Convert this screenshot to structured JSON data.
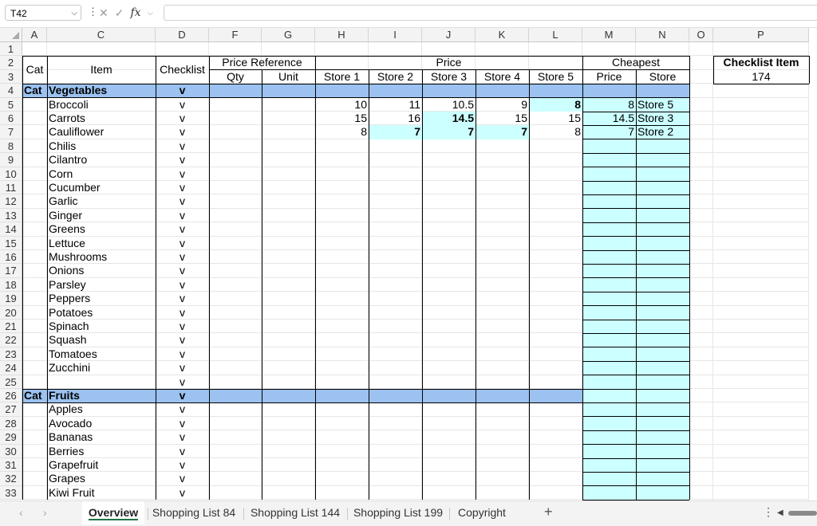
{
  "formula_bar": {
    "name_box": "T42",
    "fx_label": "fx",
    "formula": ""
  },
  "columns": [
    "A",
    "C",
    "D",
    "F",
    "G",
    "H",
    "I",
    "J",
    "K",
    "L",
    "M",
    "N",
    "O",
    "P"
  ],
  "row_numbers": [
    "1",
    "2",
    "3",
    "4",
    "5",
    "6",
    "7",
    "8",
    "9",
    "10",
    "11",
    "12",
    "13",
    "14",
    "15",
    "16",
    "17",
    "18",
    "19",
    "20",
    "21",
    "22",
    "23",
    "24",
    "25",
    "26",
    "27",
    "28",
    "29",
    "30",
    "31",
    "32",
    "33"
  ],
  "headers": {
    "cat": "Cat",
    "item": "Item",
    "checklist": "Checklist",
    "price_reference": "Price Reference",
    "qty": "Qty",
    "unit": "Unit",
    "price": "Price",
    "store1": "Store 1",
    "store2": "Store 2",
    "store3": "Store 3",
    "store4": "Store 4",
    "store5": "Store 5",
    "cheapest": "Cheapest",
    "cheapest_price": "Price",
    "cheapest_store": "Store"
  },
  "checklist_item": {
    "label": "Checklist Item",
    "value": "174"
  },
  "categories": [
    {
      "row": 4,
      "cat": "Cat",
      "name": "Vegetables",
      "check": "v"
    },
    {
      "row": 26,
      "cat": "Cat",
      "name": "Fruits",
      "check": "v"
    }
  ],
  "items": [
    {
      "row": 5,
      "name": "Broccoli",
      "check": "v",
      "prices": [
        "10",
        "11",
        "10.5",
        "9",
        "8"
      ],
      "cheapest_price": "8",
      "cheapest_store": "Store 5",
      "min_index": 4
    },
    {
      "row": 6,
      "name": "Carrots",
      "check": "v",
      "prices": [
        "15",
        "16",
        "14.5",
        "15",
        "15"
      ],
      "cheapest_price": "14.5",
      "cheapest_store": "Store 3",
      "min_index": 2
    },
    {
      "row": 7,
      "name": "Cauliflower",
      "check": "v",
      "prices": [
        "8",
        "7",
        "7",
        "7",
        "8"
      ],
      "cheapest_price": "7",
      "cheapest_store": "Store 2",
      "min_index": [
        1,
        2,
        3
      ]
    },
    {
      "row": 8,
      "name": "Chilis",
      "check": "v"
    },
    {
      "row": 9,
      "name": "Cilantro",
      "check": "v"
    },
    {
      "row": 10,
      "name": "Corn",
      "check": "v"
    },
    {
      "row": 11,
      "name": "Cucumber",
      "check": "v"
    },
    {
      "row": 12,
      "name": "Garlic",
      "check": "v"
    },
    {
      "row": 13,
      "name": "Ginger",
      "check": "v"
    },
    {
      "row": 14,
      "name": "Greens",
      "check": "v"
    },
    {
      "row": 15,
      "name": "Lettuce",
      "check": "v"
    },
    {
      "row": 16,
      "name": "Mushrooms",
      "check": "v"
    },
    {
      "row": 17,
      "name": "Onions",
      "check": "v"
    },
    {
      "row": 18,
      "name": "Parsley",
      "check": "v"
    },
    {
      "row": 19,
      "name": "Peppers",
      "check": "v"
    },
    {
      "row": 20,
      "name": "Potatoes",
      "check": "v"
    },
    {
      "row": 21,
      "name": "Spinach",
      "check": "v"
    },
    {
      "row": 22,
      "name": "Squash",
      "check": "v"
    },
    {
      "row": 23,
      "name": "Tomatoes",
      "check": "v"
    },
    {
      "row": 24,
      "name": "Zucchini",
      "check": "v"
    },
    {
      "row": 25,
      "name": "",
      "check": "v"
    },
    {
      "row": 27,
      "name": "Apples",
      "check": "v"
    },
    {
      "row": 28,
      "name": "Avocado",
      "check": "v"
    },
    {
      "row": 29,
      "name": "Bananas",
      "check": "v"
    },
    {
      "row": 30,
      "name": "Berries",
      "check": "v"
    },
    {
      "row": 31,
      "name": "Grapefruit",
      "check": "v"
    },
    {
      "row": 32,
      "name": "Grapes",
      "check": "v"
    },
    {
      "row": 33,
      "name": "Kiwi Fruit",
      "check": "v"
    }
  ],
  "sheet_tabs": [
    "Overview",
    "Shopping List 84",
    "Shopping List 144",
    "Shopping List 199",
    "Copyright"
  ],
  "active_tab": "Overview",
  "colors": {
    "category_fill": "#9bc2f0",
    "cheapest_fill": "#ccffff",
    "tab_accent": "#217346"
  }
}
